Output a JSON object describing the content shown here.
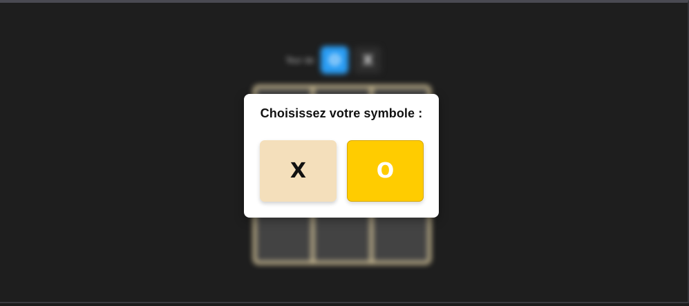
{
  "game": {
    "turn_label": "Tour de",
    "turn_options": [
      {
        "symbol": "O",
        "active": true
      },
      {
        "symbol": "X",
        "active": false
      }
    ],
    "board": [
      "",
      "",
      "",
      "",
      "",
      "",
      "",
      "",
      ""
    ]
  },
  "modal": {
    "title": "Choisissez votre symbole :",
    "choices": [
      {
        "symbol": "X"
      },
      {
        "symbol": "O"
      }
    ]
  },
  "colors": {
    "background": "#1e1e1e",
    "board_border": "#cfbf95",
    "cell": "#434343",
    "active_turn": "#2a9df4",
    "choice_x": "#f4dfbb",
    "choice_o": "#ffcc00"
  }
}
